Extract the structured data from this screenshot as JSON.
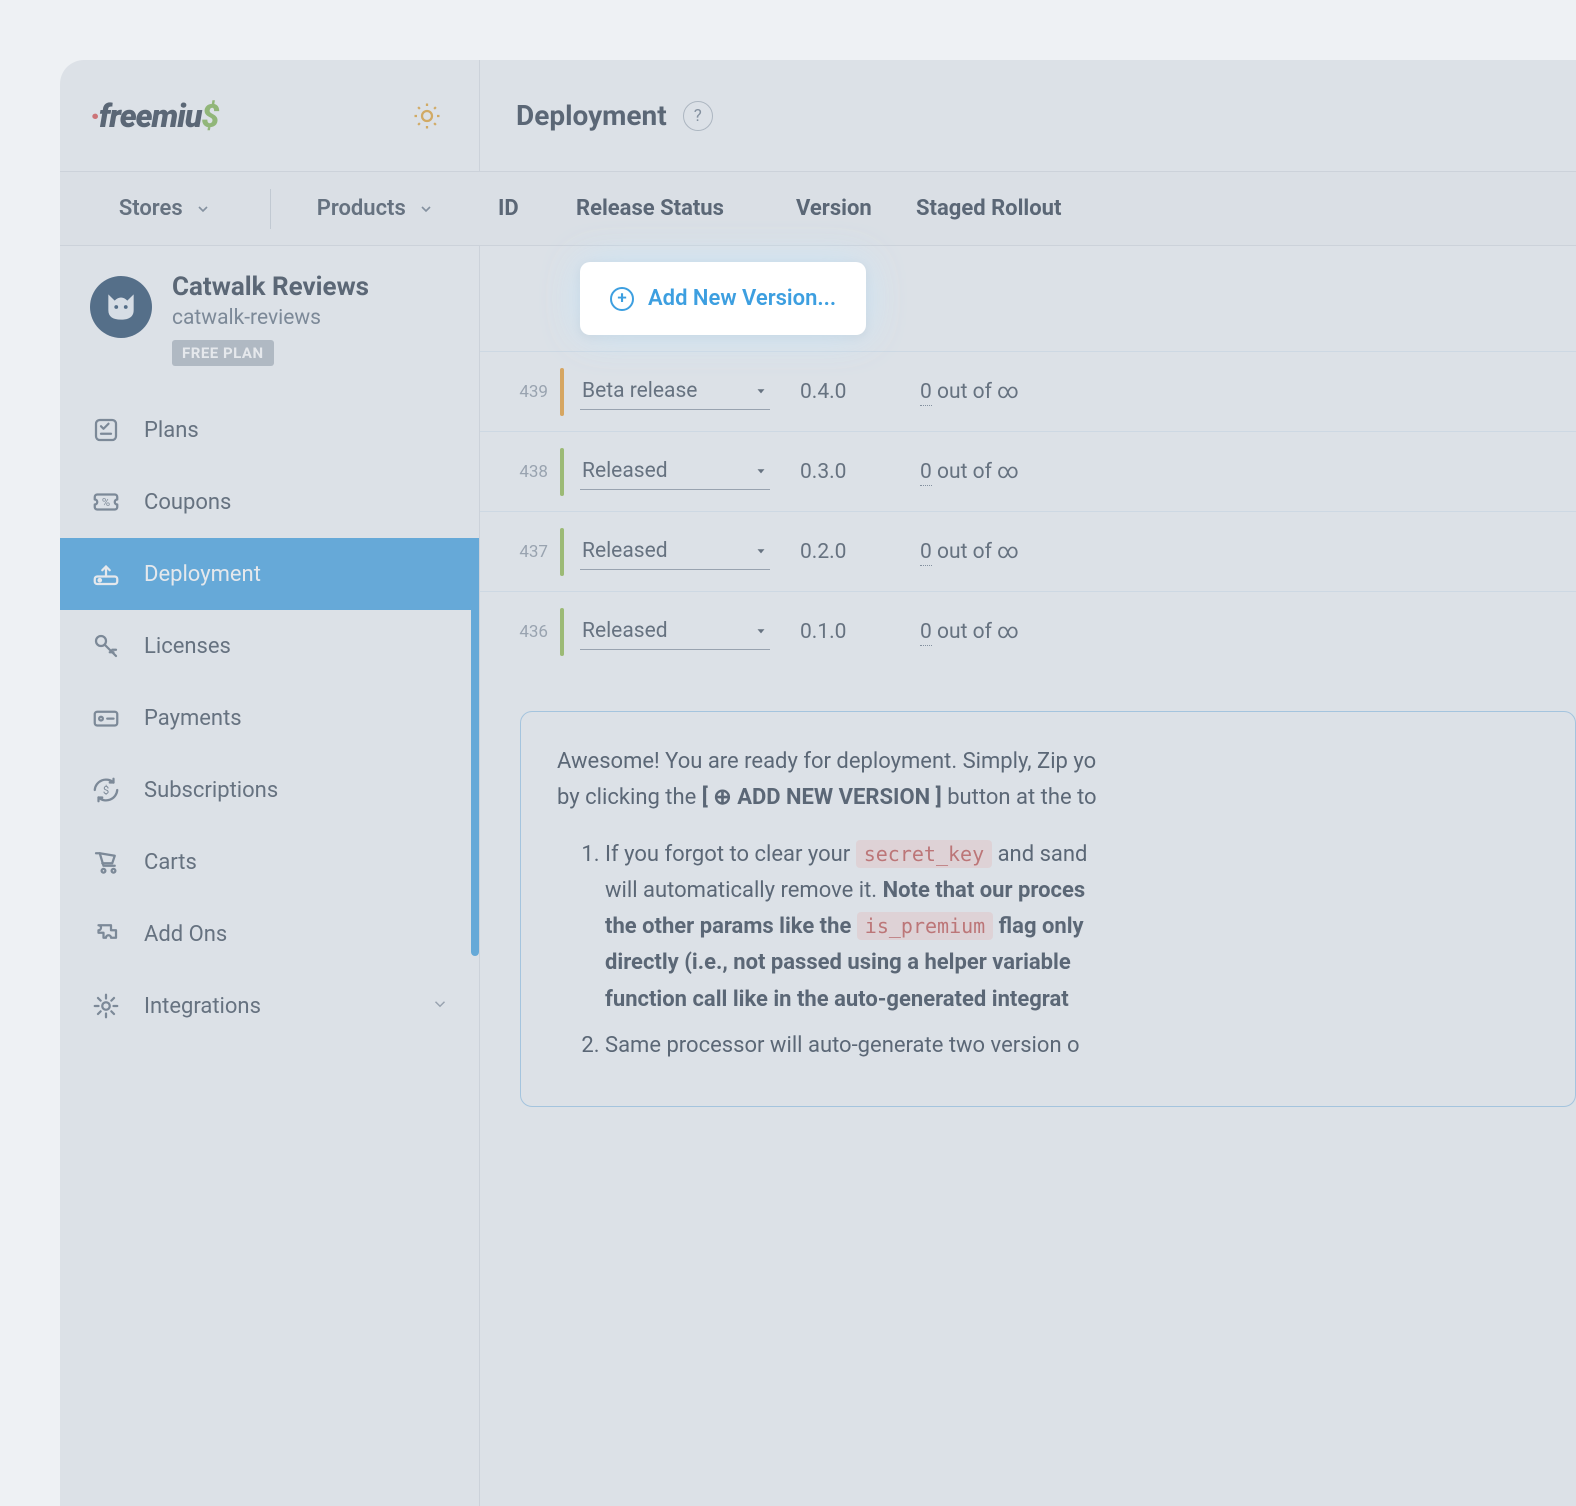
{
  "brand": {
    "name": "freemius"
  },
  "header": {
    "title": "Deployment",
    "helpSymbol": "?"
  },
  "nav": {
    "stores": "Stores",
    "products": "Products"
  },
  "tableHeaders": {
    "id": "ID",
    "status": "Release Status",
    "version": "Version",
    "rollout": "Staged Rollout"
  },
  "product": {
    "name": "Catwalk Reviews",
    "slug": "catwalk-reviews",
    "planBadge": "FREE PLAN"
  },
  "menu": [
    {
      "key": "plans",
      "label": "Plans"
    },
    {
      "key": "coupons",
      "label": "Coupons"
    },
    {
      "key": "deployment",
      "label": "Deployment",
      "active": true
    },
    {
      "key": "licenses",
      "label": "Licenses"
    },
    {
      "key": "payments",
      "label": "Payments"
    },
    {
      "key": "subscriptions",
      "label": "Subscriptions"
    },
    {
      "key": "carts",
      "label": "Carts"
    },
    {
      "key": "addons",
      "label": "Add Ons"
    },
    {
      "key": "integrations",
      "label": "Integrations",
      "expandable": true
    }
  ],
  "addButton": {
    "label": "Add New Version..."
  },
  "rows": [
    {
      "id": "439",
      "stripColor": "orange",
      "status": "Beta release",
      "version": "0.4.0",
      "rolloutNum": "0",
      "rolloutRest": " out of ∞"
    },
    {
      "id": "438",
      "stripColor": "green",
      "status": "Released",
      "version": "0.3.0",
      "rolloutNum": "0",
      "rolloutRest": " out of ∞"
    },
    {
      "id": "437",
      "stripColor": "green",
      "status": "Released",
      "version": "0.2.0",
      "rolloutNum": "0",
      "rolloutRest": " out of ∞"
    },
    {
      "id": "436",
      "stripColor": "green",
      "status": "Released",
      "version": "0.1.0",
      "rolloutNum": "0",
      "rolloutRest": " out of ∞"
    }
  ],
  "info": {
    "intro1a": "Awesome! You are ready for deployment. Simply, Zip yo",
    "intro2a": "by clicking the ",
    "intro2btn": "[ ⊕ ADD NEW VERSION ]",
    "intro2b": " button at the to",
    "li1a": "If you forgot to clear your ",
    "li1code1": "secret_key",
    "li1b": " and sand",
    "li1c": "will automatically remove it. ",
    "li1bold1": "Note that our proces",
    "li1bold2": "the other params like the ",
    "li1code2": "is_premium",
    "li1bold3": " flag only",
    "li1bold4": "directly (i.e., not passed using a helper variable",
    "li1bold5": "function call like in the auto-generated integrat",
    "li2": "Same processor will auto-generate two version o"
  }
}
